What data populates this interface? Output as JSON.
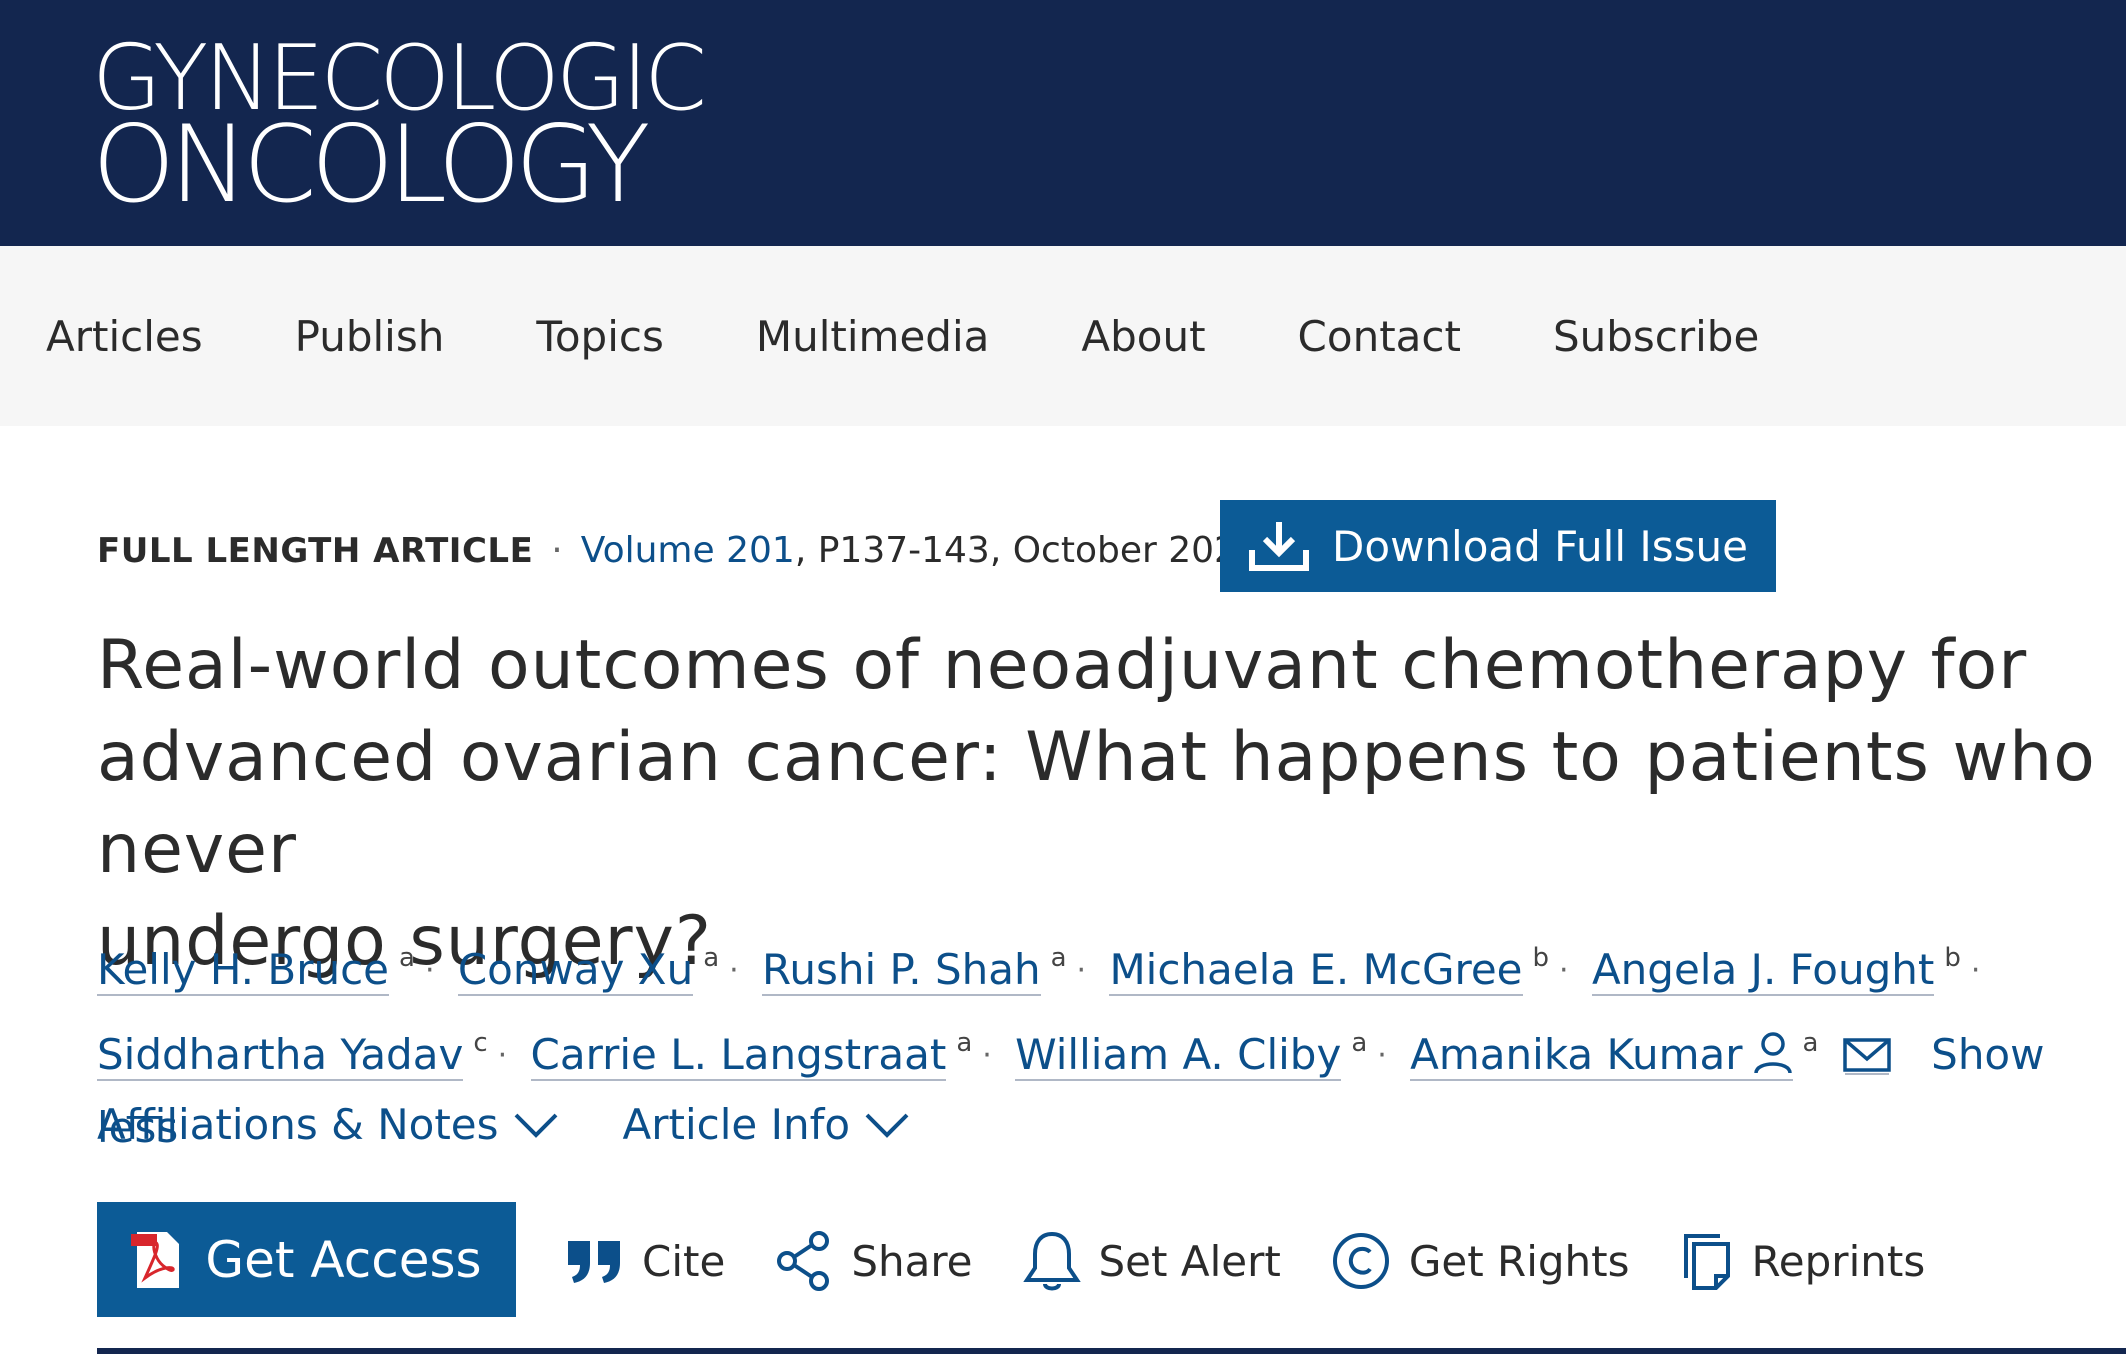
{
  "journal": {
    "logo_line1": "GYNECOLOGIC",
    "logo_line2": "ONCOLOGY"
  },
  "nav": {
    "items": [
      "Articles",
      "Publish",
      "Topics",
      "Multimedia",
      "About",
      "Contact",
      "Subscribe"
    ]
  },
  "article": {
    "type": "FULL LENGTH ARTICLE",
    "volume": "Volume 201",
    "pages_date": ", P137-143, October 2025",
    "download_label": "Download Full Issue",
    "title": "Real-world outcomes of neoadjuvant chemotherapy for\nadvanced ovarian cancer: What happens to patients who never\nundergo surgery?"
  },
  "authors": [
    {
      "name": "Kelly H. Bruce",
      "aff": "a"
    },
    {
      "name": "Conway Xu",
      "aff": "a"
    },
    {
      "name": "Rushi P. Shah",
      "aff": "a"
    },
    {
      "name": "Michaela E. McGree",
      "aff": "b"
    },
    {
      "name": "Angela J. Fought",
      "aff": "b"
    },
    {
      "name": "Siddhartha Yadav",
      "aff": "c"
    },
    {
      "name": "Carrie L. Langstraat",
      "aff": "a"
    },
    {
      "name": "William A. Cliby",
      "aff": "a"
    },
    {
      "name": "Amanika Kumar",
      "aff": "a"
    }
  ],
  "authors_ui": {
    "separator": "·",
    "show_less": "Show less"
  },
  "toggles": {
    "affiliations": "Affiliations & Notes",
    "article_info": "Article Info"
  },
  "actions": {
    "get_access": "Get Access",
    "cite": "Cite",
    "share": "Share",
    "set_alert": "Set Alert",
    "get_rights": "Get Rights",
    "reprints": "Reprints"
  },
  "colors": {
    "header_bg": "#13264f",
    "button_bg": "#0c5b96",
    "link": "#0c4f8a"
  }
}
